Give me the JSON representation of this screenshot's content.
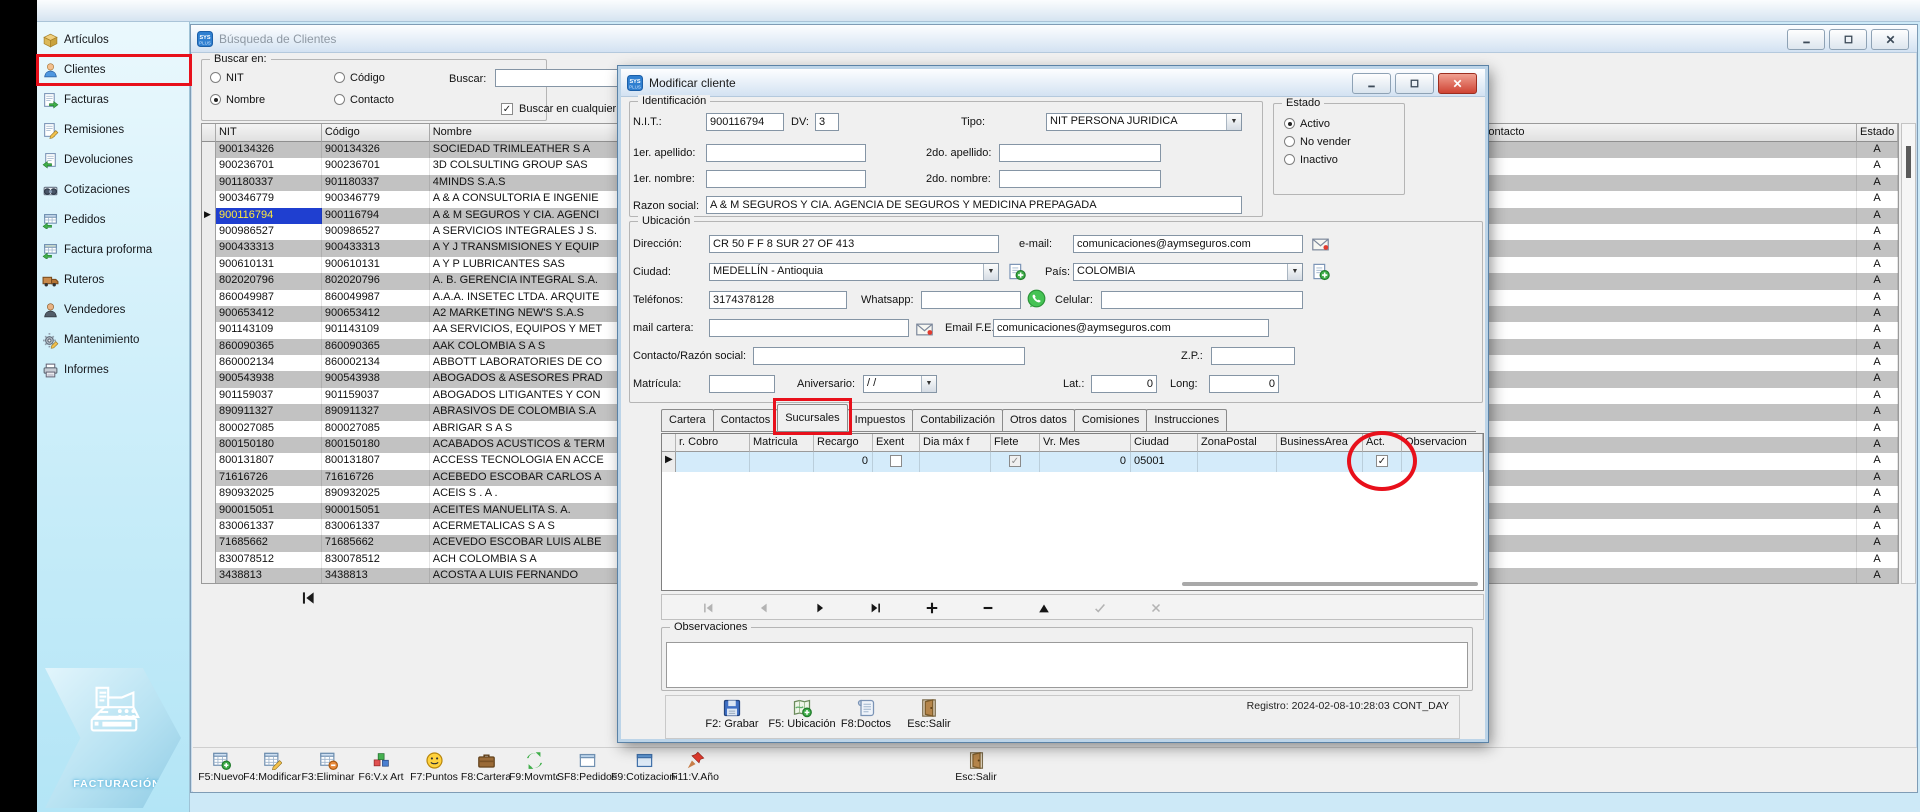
{
  "annotations": {
    "color": "#e8101b"
  },
  "app": {
    "logo_text": "FACTURACIÓN"
  },
  "sidebar": {
    "items": [
      {
        "label": "Artículos",
        "icon": "package-icon"
      },
      {
        "label": "Clientes",
        "icon": "client-icon",
        "highlighted": true
      },
      {
        "label": "Facturas",
        "icon": "invoice-icon"
      },
      {
        "label": "Remisiones",
        "icon": "remission-icon"
      },
      {
        "label": "Devoluciones",
        "icon": "returns-icon"
      },
      {
        "label": "Cotizaciones",
        "icon": "quotes-icon"
      },
      {
        "label": "Pedidos",
        "icon": "orders-icon"
      },
      {
        "label": "Factura proforma",
        "icon": "proforma-icon"
      },
      {
        "label": "Ruteros",
        "icon": "truck-icon"
      },
      {
        "label": "Vendedores",
        "icon": "seller-icon"
      },
      {
        "label": "Mantenimiento",
        "icon": "gear-icon"
      },
      {
        "label": "Informes",
        "icon": "printer-icon"
      }
    ]
  },
  "search_window": {
    "title": "Búsqueda de Clientes",
    "window_icon": "sys-icon",
    "search_in": {
      "legend": "Buscar en:",
      "options": [
        {
          "label": "NIT",
          "selected": false
        },
        {
          "label": "Código",
          "selected": false
        },
        {
          "label": "Nombre",
          "selected": true
        },
        {
          "label": "Contacto",
          "selected": false
        }
      ]
    },
    "buscar_label": "Buscar:",
    "buscar_value": "",
    "anywhere": {
      "label": "Buscar en cualquier p",
      "checked": true
    },
    "grid": {
      "columns": [
        "NIT",
        "Código",
        "Nombre",
        "Contacto",
        "Estado"
      ],
      "selected_row": 4,
      "rows": [
        [
          "900134326",
          "900134326",
          "SOCIEDAD TRIMLEATHER S A",
          "A"
        ],
        [
          "900236701",
          "900236701",
          "3D COLSULTING GROUP SAS",
          "A"
        ],
        [
          "901180337",
          "901180337",
          "4MINDS S.A.S",
          "A"
        ],
        [
          "900346779",
          "900346779",
          "A & A CONSULTORIA E INGENIE",
          "A"
        ],
        [
          "900116794",
          "900116794",
          "A & M SEGUROS Y CIA. AGENCI",
          "A"
        ],
        [
          "900986527",
          "900986527",
          "A SERVICIOS INTEGRALES J S.",
          "A"
        ],
        [
          "900433313",
          "900433313",
          "A Y J TRANSMISIONES Y EQUIP",
          "A"
        ],
        [
          "900610131",
          "900610131",
          "A Y P LUBRICANTES SAS",
          "A"
        ],
        [
          "802020796",
          "802020796",
          "A. B. GERENCIA INTEGRAL S.A.",
          "A"
        ],
        [
          "860049987",
          "860049987",
          "A.A.A. INSETEC LTDA. ARQUITE",
          "A"
        ],
        [
          "900653412",
          "900653412",
          "A2 MARKETING NEW'S S.A.S",
          "A"
        ],
        [
          "901143109",
          "901143109",
          "AA SERVICIOS, EQUIPOS Y MET",
          "A"
        ],
        [
          "860090365",
          "860090365",
          "AAK COLOMBIA S A S",
          "A"
        ],
        [
          "860002134",
          "860002134",
          "ABBOTT LABORATORIES DE CO",
          "A"
        ],
        [
          "900543938",
          "900543938",
          "ABOGADOS & ASESORES PRAD",
          "A"
        ],
        [
          "901159037",
          "901159037",
          "ABOGADOS LITIGANTES Y CON",
          "A"
        ],
        [
          "890911327",
          "890911327",
          "ABRASIVOS DE COLOMBIA S.A",
          "A"
        ],
        [
          "800027085",
          "800027085",
          "ABRIGAR S A S",
          "A"
        ],
        [
          "800150180",
          "800150180",
          "ACABADOS ACUSTICOS & TERM",
          "A"
        ],
        [
          "800131807",
          "800131807",
          "ACCESS TECNOLOGIA EN ACCE",
          "A"
        ],
        [
          "71616726",
          "71616726",
          "ACEBEDO ESCOBAR CARLOS A",
          "A"
        ],
        [
          "890932025",
          "890932025",
          "ACEIS S . A .",
          "A"
        ],
        [
          "900015051",
          "900015051",
          "ACEITES MANUELITA S. A.",
          "A"
        ],
        [
          "830061337",
          "830061337",
          "ACERMETALICAS S A S",
          "A"
        ],
        [
          "71685662",
          "71685662",
          "ACEVEDO ESCOBAR LUIS ALBE",
          "A"
        ],
        [
          "830078512",
          "830078512",
          "ACH COLOMBIA S A",
          "A"
        ],
        [
          "3438813",
          "3438813",
          "ACOSTA A LUIS FERNANDO",
          "A"
        ]
      ]
    },
    "toolbar": [
      {
        "label": "F5:Nuevo",
        "icon": "table-new-icon"
      },
      {
        "label": "F4:Modificar",
        "icon": "table-edit-icon"
      },
      {
        "label": "F3:Eliminar",
        "icon": "table-delete-icon"
      },
      {
        "label": "F6:V.x Art",
        "icon": "cubes-icon"
      },
      {
        "label": "F7:Puntos",
        "icon": "smiley-icon"
      },
      {
        "label": "F8:Cartera",
        "icon": "briefcase-icon"
      },
      {
        "label": "F9:Movmto.",
        "icon": "recycle-icon"
      },
      {
        "label": "SF8:Pedidos",
        "icon": "panel-icon"
      },
      {
        "label": "F9:Cotizaciones",
        "icon": "panel-blue-icon"
      },
      {
        "label": "F11:V.Año",
        "icon": "pin-red-icon"
      },
      {
        "label": "Esc:Salir",
        "icon": "exit-icon"
      }
    ]
  },
  "modal": {
    "title": "Modificar cliente",
    "window_icon": "sys-icon",
    "identificacion": {
      "legend": "Identificación",
      "nit_label": "N.I.T.:",
      "nit": "900116794",
      "dv_label": "DV:",
      "dv": "3",
      "tipo_label": "Tipo:",
      "tipo": "NIT PERSONA JURIDICA",
      "ap1_label": "1er. apellido:",
      "ap1": "",
      "ap2_label": "2do. apellido:",
      "ap2": "",
      "nom1_label": "1er. nombre:",
      "nom1": "",
      "nom2_label": "2do. nombre:",
      "nom2": "",
      "razon_label": "Razon social:",
      "razon": "A & M SEGUROS Y CIA. AGENCIA DE SEGUROS Y MEDICINA PREPAGADA"
    },
    "estado": {
      "legend": "Estado",
      "options": [
        {
          "label": "Activo",
          "selected": true
        },
        {
          "label": "No vender",
          "selected": false
        },
        {
          "label": "Inactivo",
          "selected": false
        }
      ]
    },
    "ubicacion": {
      "legend": "Ubicación",
      "direccion_label": "Dirección:",
      "direccion": "CR 50 F F 8 SUR 27 OF 413",
      "email_label": "e-mail:",
      "email": "comunicaciones@aymseguros.com",
      "ciudad_label": "Ciudad:",
      "ciudad": "MEDELLÍN - Antioquia",
      "pais_label": "País:",
      "pais": "COLOMBIA",
      "telefonos_label": "Teléfonos:",
      "telefonos": "3174378128",
      "whatsapp_label": "Whatsapp:",
      "whatsapp": "",
      "celular_label": "Celular:",
      "celular": "",
      "mail_cartera_label": "mail cartera:",
      "mail_cartera": "",
      "email_fe_label": "Email F.E.:",
      "email_fe": "comunicaciones@aymseguros.com",
      "contacto_label": "Contacto/Razón social:",
      "contacto_razon": "",
      "zp_label": "Z.P.:",
      "zp": "",
      "matricula_label": "Matrícula:",
      "matricula": "",
      "aniversario_label": "Aniversario:",
      "aniversario": "/ /",
      "lat_label": "Lat.:",
      "lat": "0",
      "long_label": "Long:",
      "long": "0"
    },
    "tabs": [
      {
        "label": "Cartera"
      },
      {
        "label": "Contactos"
      },
      {
        "label": "Sucursales",
        "selected": true,
        "annotated": true
      },
      {
        "label": "Impuestos"
      },
      {
        "label": "Contabilización"
      },
      {
        "label": "Otros datos"
      },
      {
        "label": "Comisiones"
      },
      {
        "label": "Instrucciones"
      }
    ],
    "sucursales_grid": {
      "columns": [
        "r. Cobro",
        "Matricula",
        "Recargo",
        "Exent",
        "Dia máx f",
        "Flete",
        "Vr. Mes",
        "Ciudad",
        "ZonaPostal",
        "BusinessArea",
        "Act.",
        "Observacion"
      ],
      "row": {
        "recargo": "0",
        "exento": false,
        "flete": true,
        "vr_mes": "0",
        "ciudad": "05001",
        "act": true
      }
    },
    "navigator": [
      {
        "name": "nav-first",
        "enabled": false
      },
      {
        "name": "nav-prior",
        "enabled": false
      },
      {
        "name": "nav-next",
        "enabled": true
      },
      {
        "name": "nav-last",
        "enabled": true
      },
      {
        "name": "nav-insert",
        "enabled": true
      },
      {
        "name": "nav-delete",
        "enabled": true
      },
      {
        "name": "nav-edit",
        "enabled": true
      },
      {
        "name": "nav-post",
        "enabled": false
      },
      {
        "name": "nav-cancel",
        "enabled": false
      }
    ],
    "observaciones": {
      "legend": "Observaciones",
      "value": ""
    },
    "buttons": [
      {
        "label": "F2: Grabar",
        "icon": "save-icon"
      },
      {
        "label": "F5: Ubicación",
        "icon": "map-icon"
      },
      {
        "label": "F8:Doctos",
        "icon": "docs-icon"
      },
      {
        "label": "Esc:Salir",
        "icon": "exit-icon"
      }
    ],
    "registro": "Registro: 2024-02-08-10:28:03 CONT_DAY"
  }
}
